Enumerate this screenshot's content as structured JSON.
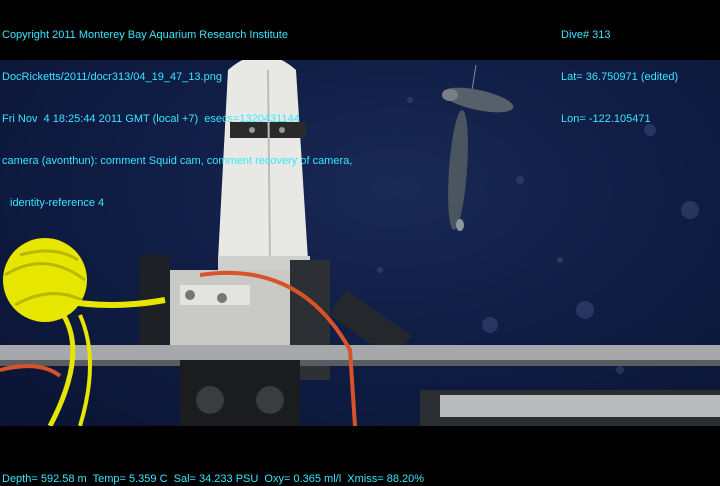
{
  "overlay_top_left": [
    "Copyright 2011 Monterey Bay Aquarium Research Institute",
    "DocRicketts/2011/docr313/04_19_47_13.png",
    "Fri Nov  4 18:25:44 2011 GMT (local +7)  esecs=1320431144",
    "camera (avonthun): comment Squid cam, comment recovery of camera,",
    "identity-reference 4"
  ],
  "overlay_top_right": [
    "Dive# 313",
    "Lat= 36.750971 (edited)",
    "Lon= -122.105471"
  ],
  "overlay_bottom": "Depth= 592.58 m  Temp= 5.359 C  Sal= 34.233 PSU  Oxy= 0.365 ml/l  Xmiss= 88.20%",
  "colors": {
    "overlay_text": "#39e6ff",
    "water": "#101d45",
    "frame": "#000000"
  }
}
